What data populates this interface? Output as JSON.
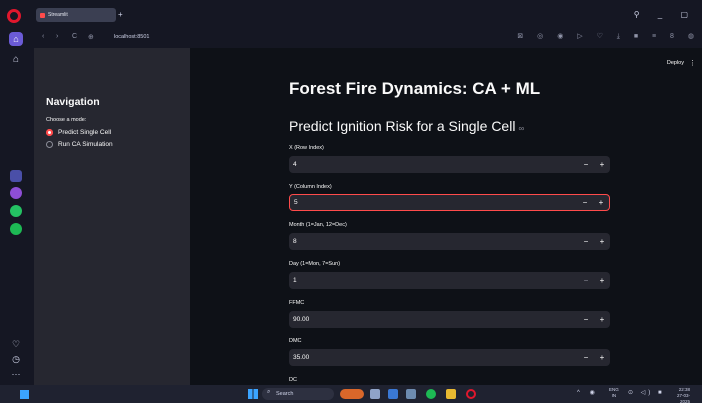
{
  "browser": {
    "tab_title": "Streamlit",
    "url": "localhost:8501",
    "new_tab_glyph": "+",
    "window_controls": "⚲ _ ▢",
    "nav_icons": {
      "back": "‹",
      "forward": "›",
      "reload": "C",
      "site": "⊕"
    },
    "toolbar_icons": "⊠ ◎ ◉ ▷ ♡ ⤓ ■ ≡ 8 ◍"
  },
  "opera_sidebar": {
    "home_icon": "⌂",
    "gift_icon": "⌂",
    "bottom_icons": [
      "♡",
      "◷",
      "···"
    ]
  },
  "app": {
    "deploy_label": "Deploy",
    "menu_glyph": "⋮",
    "sidebar": {
      "title": "Navigation",
      "mode_label": "Choose a mode:",
      "options": [
        {
          "label": "Predict Single Cell",
          "selected": true
        },
        {
          "label": "Run CA Simulation",
          "selected": false
        }
      ]
    },
    "title": "Forest Fire Dynamics: CA + ML",
    "subtitle": "Predict Ignition Risk for a Single Cell",
    "link_glyph": "∞",
    "step_minus": "−",
    "step_plus": "+",
    "fields": [
      {
        "label": "X (Row Index)",
        "value": "4"
      },
      {
        "label": "Y (Column Index)",
        "value": "5"
      },
      {
        "label": "Month (1=Jan, 12=Dec)",
        "value": "8"
      },
      {
        "label": "Day (1=Mon, 7=Sun)",
        "value": "1"
      },
      {
        "label": "FFMC",
        "value": "90.00"
      },
      {
        "label": "DMC",
        "value": "35.00"
      },
      {
        "label": "DC",
        "value": ""
      }
    ],
    "active_field_color": "#ff4b4b"
  },
  "taskbar": {
    "search_label": "Search",
    "search_glyph": "⌕",
    "tray_icons": "^ ◉",
    "lang_line1": "ENG",
    "lang_line2": "IN",
    "tray_status": "⊙ ◁) ■",
    "time": "22:38",
    "date": "27-03-2025"
  }
}
